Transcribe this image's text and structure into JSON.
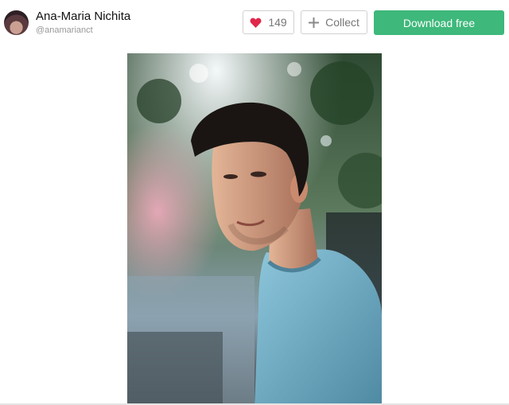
{
  "author": {
    "name": "Ana-Maria Nichita",
    "handle": "@anamarianct"
  },
  "actions": {
    "like_count": "149",
    "collect_label": "Collect",
    "download_label": "Download free"
  },
  "icons": {
    "like": "heart-icon",
    "collect": "plus-icon"
  },
  "colors": {
    "download_button": "#3eb87b",
    "heart": "#e0274b"
  }
}
